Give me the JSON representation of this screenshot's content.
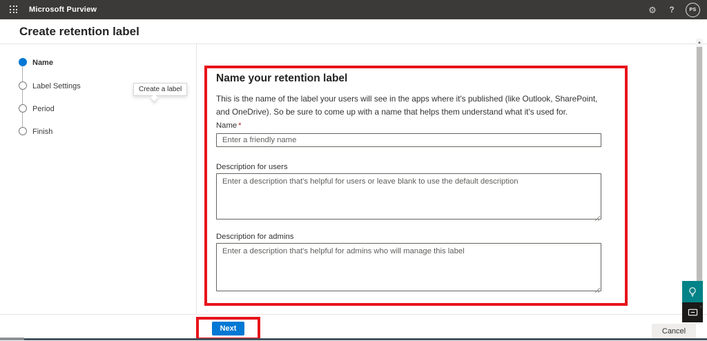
{
  "topbar": {
    "app_title": "Microsoft Purview",
    "settings_glyph": "⚙",
    "help_glyph": "?",
    "avatar_initials": "PS"
  },
  "page": {
    "title": "Create retention label"
  },
  "wizard": {
    "tooltip": "Create a label",
    "steps": [
      {
        "label": "Name",
        "state": "active"
      },
      {
        "label": "Label Settings",
        "state": "pending"
      },
      {
        "label": "Period",
        "state": "pending"
      },
      {
        "label": "Finish",
        "state": "pending"
      }
    ]
  },
  "form": {
    "heading": "Name your retention label",
    "description": "This is the name of the label your users will see in the apps where it's published (like Outlook, SharePoint, and OneDrive). So be sure to come up with a name that helps them understand what it's used for.",
    "name_field": {
      "label": "Name",
      "required_marker": "*",
      "placeholder": "Enter a friendly name"
    },
    "user_desc_field": {
      "label": "Description for users",
      "placeholder": "Enter a description that's helpful for users or leave blank to use the default description"
    },
    "admin_desc_field": {
      "label": "Description for admins",
      "placeholder": "Enter a description that's helpful for admins who will manage this label"
    }
  },
  "footer": {
    "next_label": "Next",
    "cancel_label": "Cancel"
  },
  "colors": {
    "topbar_bg": "#3b3a39",
    "accent_blue": "#0078d4",
    "annotation_red": "#e8131b",
    "teal_widget": "#038387",
    "feedback_black": "#1b1a19"
  }
}
